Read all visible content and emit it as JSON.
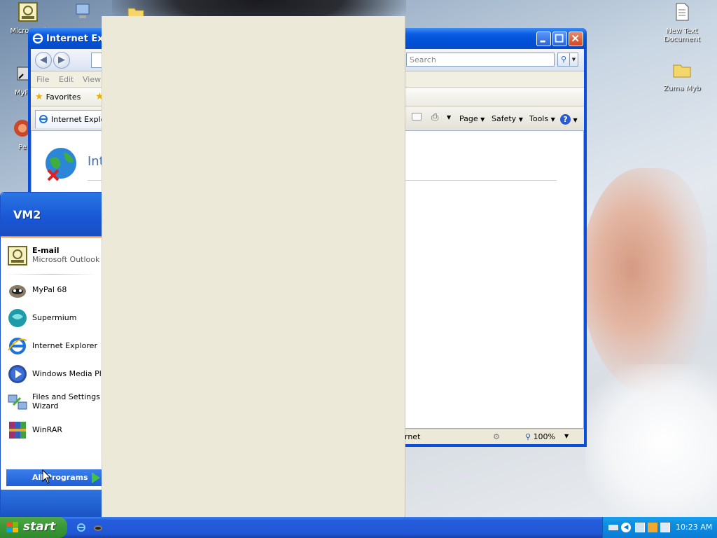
{
  "desktop": {
    "icons": [
      {
        "label": "Micro Outl"
      },
      {
        "label": "MyPa"
      },
      {
        "label": "Pe"
      },
      {
        "label": "New Text Document"
      },
      {
        "label": "Zuma Myb"
      }
    ]
  },
  "ie_window": {
    "title": "Internet Expl",
    "search_placeholder": "Search",
    "menu": [
      "File",
      "Edit",
      "View"
    ],
    "favorites_label": "Favorites",
    "tab_label": "Internet Explor",
    "commands": {
      "page": "Page",
      "safety": "Safety",
      "tools": "Tools"
    },
    "content_title": "Int",
    "status_text": "rnet",
    "zoom_level": "100%"
  },
  "start_menu": {
    "user": "VM2",
    "pinned": [
      {
        "label": "E-mail",
        "sub": "Microsoft Outlook"
      }
    ],
    "recent": [
      {
        "label": "MyPal 68"
      },
      {
        "label": "Supermium"
      },
      {
        "label": "Internet Explorer"
      },
      {
        "label": "Windows Media Playe"
      },
      {
        "label": "Files and Settings Tra",
        "label2": "Wizard"
      },
      {
        "label": "WinRAR"
      }
    ],
    "all_programs": "All Programs"
  },
  "taskbar": {
    "start_label": "start",
    "clock": "10:23 AM"
  },
  "colors": {
    "xp_blue": "#0a4fdc",
    "start_green": "#3c9939",
    "tray_blue": "#0f8fe0",
    "panel_beige": "#ece9d8"
  }
}
